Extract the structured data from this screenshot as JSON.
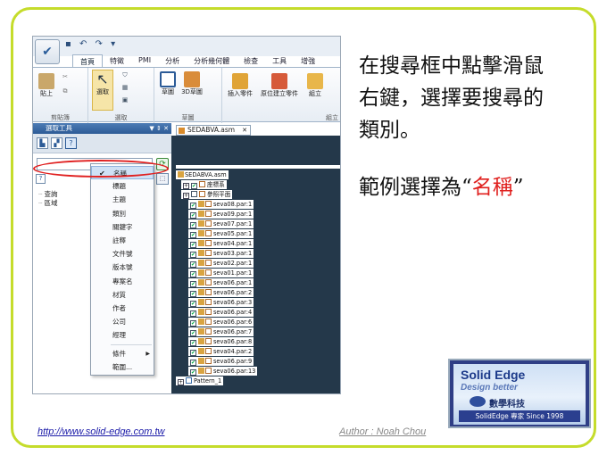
{
  "qat": "▪ ↶ ↷ ▾",
  "ribbon": {
    "tabs": [
      "首頁",
      "特徵",
      "PMI",
      "分析",
      "分析幾何體",
      "檢查",
      "工具",
      "增強"
    ],
    "groups": [
      {
        "label": "剪貼簿",
        "buttons": [
          "貼上"
        ]
      },
      {
        "label": "選取",
        "buttons": [
          "選取"
        ]
      },
      {
        "label": "草圖",
        "buttons": [
          "草圖",
          "3D草圖"
        ]
      },
      {
        "label": "組立",
        "buttons": [
          "插入零件",
          "原位建立零件",
          "組立"
        ]
      }
    ]
  },
  "left_pane": {
    "title": "選取工具",
    "controls": "▼ ⇕ ✕",
    "tree": [
      "查詢",
      "區域"
    ]
  },
  "context_menu": {
    "items": [
      {
        "label": "名稱",
        "checked": true
      },
      {
        "label": "標題"
      },
      {
        "label": "主題"
      },
      {
        "label": "類別"
      },
      {
        "label": "關鍵字"
      },
      {
        "label": "註釋"
      },
      {
        "label": "文件號"
      },
      {
        "label": "版本號"
      },
      {
        "label": "專案名"
      },
      {
        "label": "材質"
      },
      {
        "label": "作者"
      },
      {
        "label": "公司"
      },
      {
        "label": "經理"
      },
      {
        "label": "條件",
        "submenu": true
      },
      {
        "label": "範圍..."
      }
    ]
  },
  "doc": {
    "tab": "SEDABVA.asm",
    "root": "SEDABVA.asm",
    "nodes": [
      "座標系",
      "參照平面",
      "seva08.par:1",
      "seva09.par:1",
      "seva07.par:1",
      "seva05.par:1",
      "seva04.par:1",
      "seva03.par:1",
      "seva02.par:1",
      "seva01.par:1",
      "seva06.par:1",
      "seva06.par:2",
      "seva06.par:3",
      "seva06.par:4",
      "seva06.par:6",
      "seva06.par:7",
      "seva06.par:8",
      "seva04.par:2",
      "seva06.par:9",
      "seva06.par:13",
      "Pattern_1"
    ]
  },
  "instructions": [
    "在搜尋框中點擊滑鼠",
    "右鍵，選擇要搜尋的",
    "類別。"
  ],
  "example": {
    "prefix": "範例選擇為“",
    "highlight": "名稱",
    "suffix": "”"
  },
  "logo": {
    "title": "Solid Edge",
    "subtitle": "Design better",
    "company": "數學科技",
    "since": "SolidEdge 專家 Since 1998"
  },
  "footer": {
    "url": "http://www.solid-edge.com.tw",
    "author": "Author : Noah Chou"
  },
  "colors": {
    "frame": "#c5dc2b",
    "highlight": "#e0201e",
    "docbg": "#24384a"
  }
}
